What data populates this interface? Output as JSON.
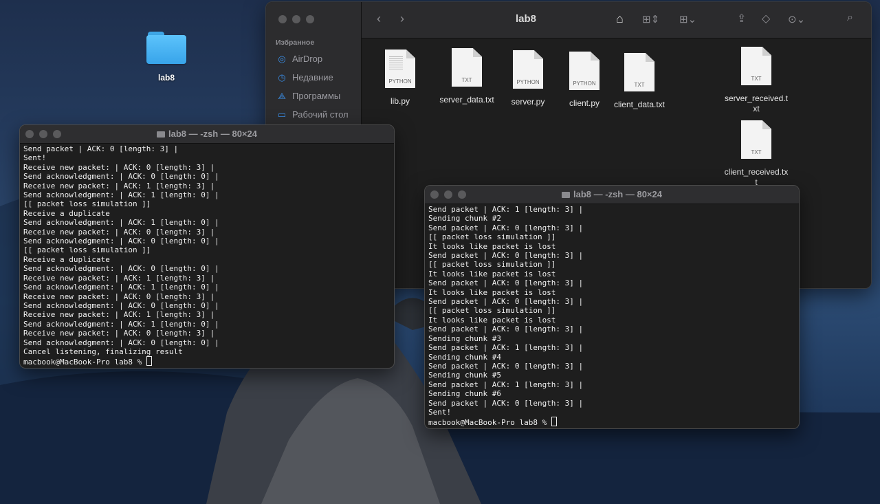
{
  "desktop": {
    "folder_label": "lab8"
  },
  "finder": {
    "title": "lab8",
    "sidebar_heading": "Избранное",
    "sidebar_items": [
      {
        "label": "AirDrop",
        "icon": "airdrop-icon"
      },
      {
        "label": "Недавние",
        "icon": "recents-icon"
      },
      {
        "label": "Программы",
        "icon": "applications-icon"
      },
      {
        "label": "Рабочий стол",
        "icon": "desktop-icon"
      }
    ],
    "files": [
      {
        "name": "lib.py",
        "type": "PYTHON"
      },
      {
        "name": "server_data.txt",
        "type": "TXT"
      },
      {
        "name": "server.py",
        "type": "PYTHON"
      },
      {
        "name": "client.py",
        "type": "PYTHON"
      },
      {
        "name": "client_data.txt",
        "type": "TXT"
      },
      {
        "name": "server_received.t\nxt",
        "type": "TXT"
      },
      {
        "name": "client_received.tx\nt",
        "type": "TXT"
      }
    ]
  },
  "terminal_left": {
    "title": "lab8 — -zsh — 80×24",
    "lines": [
      "Send packet | ACK: 0 [length: 3] |",
      "Sent!",
      "Receive new packet: | ACK: 0 [length: 3] |",
      "Send acknowledgment: | ACK: 0 [length: 0] |",
      "Receive new packet: | ACK: 1 [length: 3] |",
      "Send acknowledgment: | ACK: 1 [length: 0] |",
      "[[ packet loss simulation ]]",
      "Receive a duplicate",
      "Send acknowledgment: | ACK: 1 [length: 0] |",
      "Receive new packet: | ACK: 0 [length: 3] |",
      "Send acknowledgment: | ACK: 0 [length: 0] |",
      "[[ packet loss simulation ]]",
      "Receive a duplicate",
      "Send acknowledgment: | ACK: 0 [length: 0] |",
      "Receive new packet: | ACK: 1 [length: 3] |",
      "Send acknowledgment: | ACK: 1 [length: 0] |",
      "Receive new packet: | ACK: 0 [length: 3] |",
      "Send acknowledgment: | ACK: 0 [length: 0] |",
      "Receive new packet: | ACK: 1 [length: 3] |",
      "Send acknowledgment: | ACK: 1 [length: 0] |",
      "Receive new packet: | ACK: 0 [length: 3] |",
      "Send acknowledgment: | ACK: 0 [length: 0] |",
      "Cancel listening, finalizing result"
    ],
    "prompt": "macbook@MacBook-Pro lab8 % "
  },
  "terminal_right": {
    "title": "lab8 — -zsh — 80×24",
    "lines": [
      "Send packet | ACK: 1 [length: 3] |",
      "Sending chunk #2",
      "Send packet | ACK: 0 [length: 3] |",
      "[[ packet loss simulation ]]",
      "It looks like packet is lost",
      "Send packet | ACK: 0 [length: 3] |",
      "[[ packet loss simulation ]]",
      "It looks like packet is lost",
      "Send packet | ACK: 0 [length: 3] |",
      "It looks like packet is lost",
      "Send packet | ACK: 0 [length: 3] |",
      "[[ packet loss simulation ]]",
      "It looks like packet is lost",
      "Send packet | ACK: 0 [length: 3] |",
      "Sending chunk #3",
      "Send packet | ACK: 1 [length: 3] |",
      "Sending chunk #4",
      "Send packet | ACK: 0 [length: 3] |",
      "Sending chunk #5",
      "Send packet | ACK: 1 [length: 3] |",
      "Sending chunk #6",
      "Send packet | ACK: 0 [length: 3] |",
      "Sent!"
    ],
    "prompt": "macbook@MacBook-Pro lab8 % "
  }
}
